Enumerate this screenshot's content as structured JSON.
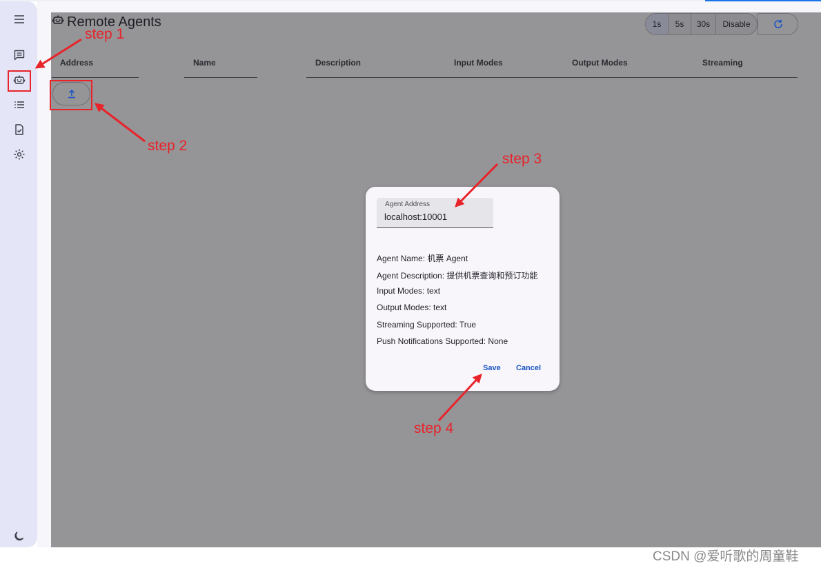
{
  "page": {
    "title": "Remote Agents"
  },
  "refresh_intervals": [
    "1s",
    "5s",
    "30s",
    "Disable"
  ],
  "table": {
    "columns": [
      "Address",
      "Name",
      "Description",
      "Input Modes",
      "Output Modes",
      "Streaming"
    ]
  },
  "dialog": {
    "field_label": "Agent Address",
    "field_value": "localhost:10001",
    "info": [
      "Agent Name: 机票 Agent",
      "Agent Description: 提供机票查询和预订功能",
      "Input Modes: text",
      "Output Modes: text",
      "Streaming Supported: True",
      "Push Notifications Supported: None"
    ],
    "save_label": "Save",
    "cancel_label": "Cancel"
  },
  "annotations": {
    "steps": [
      "step 1",
      "step 2",
      "step 3",
      "step 4"
    ],
    "color": "#e8232a"
  },
  "icons": [
    "menu-icon",
    "chat-icon",
    "robot-icon",
    "list-icon",
    "task-icon",
    "settings-icon",
    "moon-icon",
    "upload-icon",
    "refresh-icon"
  ],
  "colors": {
    "accent": "#1a55c4",
    "sidebar": "#e4e6f7",
    "overlay": "#959497"
  },
  "watermark": "CSDN @爱听歌的周童鞋"
}
